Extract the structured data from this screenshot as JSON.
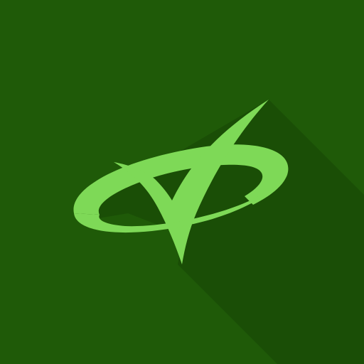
{
  "icon": {
    "name": "checkmark-orbit-logo",
    "colors": {
      "background": "#1f5a08",
      "shadow": "#1a4e06",
      "mark": "#7ed957"
    }
  }
}
